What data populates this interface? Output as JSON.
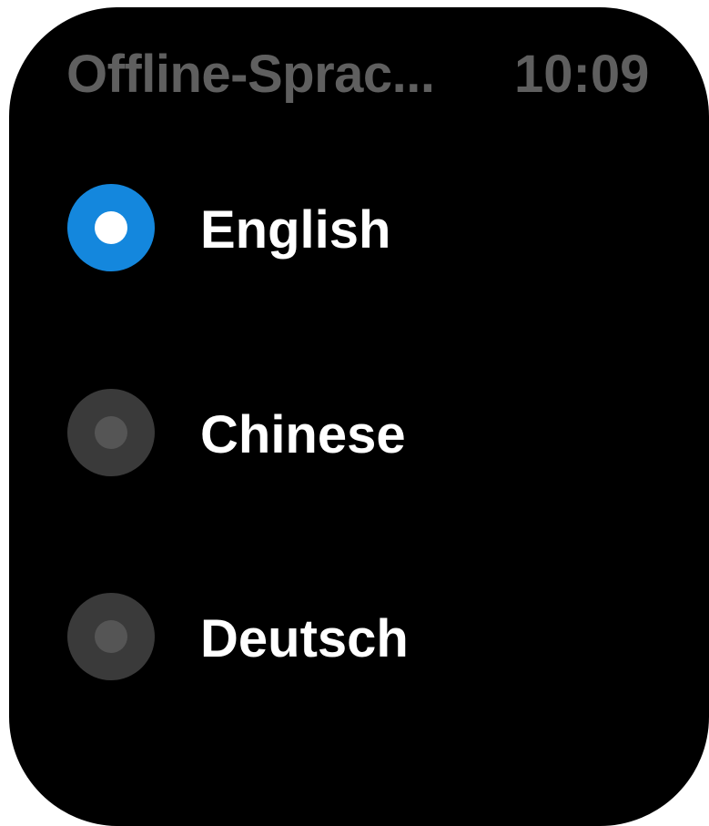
{
  "header": {
    "title": "Offline-Sprac...",
    "time": "10:09"
  },
  "options": [
    {
      "label": "English",
      "selected": true
    },
    {
      "label": "Chinese",
      "selected": false
    },
    {
      "label": "Deutsch",
      "selected": false
    }
  ],
  "colors": {
    "background": "#000000",
    "header_text": "#5f5f5f",
    "accent": "#1487dd",
    "radio_unselected": "#3a3a3a",
    "label_text": "#ffffff"
  }
}
